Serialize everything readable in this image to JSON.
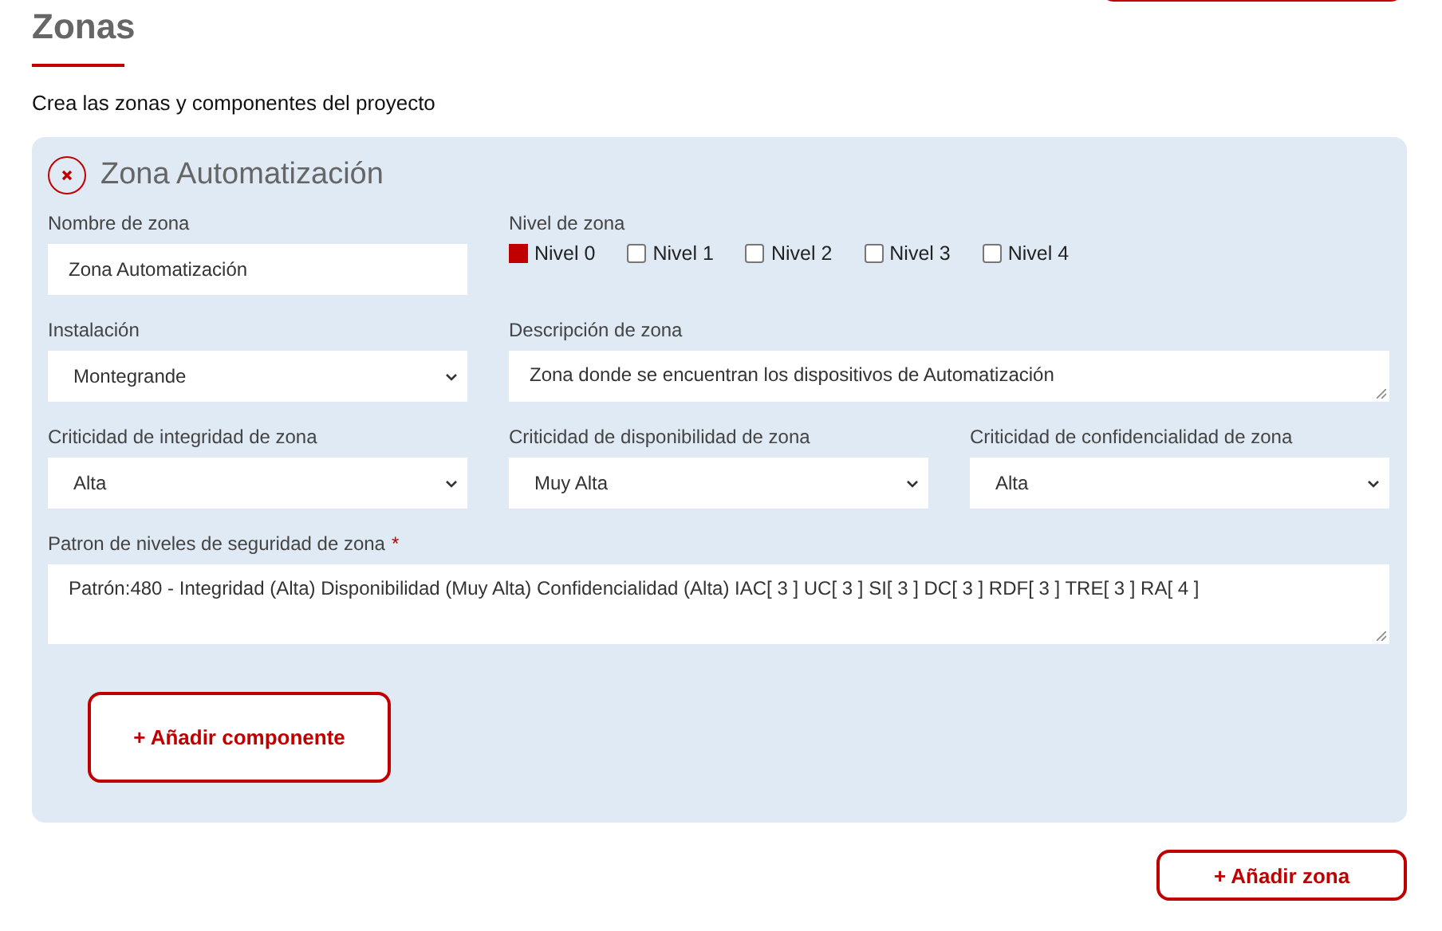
{
  "page": {
    "title": "Zonas",
    "subtitle": "Crea las zonas y componentes del proyecto"
  },
  "zone": {
    "title": "Zona Automatización",
    "name_field": {
      "label": "Nombre de zona",
      "value": "Zona Automatización"
    },
    "level": {
      "label": "Nivel de zona",
      "options": [
        {
          "label": "Nivel 0",
          "checked": true
        },
        {
          "label": "Nivel 1",
          "checked": false
        },
        {
          "label": "Nivel 2",
          "checked": false
        },
        {
          "label": "Nivel 3",
          "checked": false
        },
        {
          "label": "Nivel 4",
          "checked": false
        }
      ]
    },
    "installation": {
      "label": "Instalación",
      "value": "Montegrande"
    },
    "description": {
      "label": "Descripción de zona",
      "value": "Zona donde se encuentran los dispositivos de Automatización"
    },
    "criticality": [
      {
        "label": "Criticidad de integridad de zona",
        "value": "Alta"
      },
      {
        "label": "Criticidad de disponibilidad de zona",
        "value": "Muy Alta"
      },
      {
        "label": "Criticidad de confidencialidad de zona",
        "value": "Alta"
      }
    ],
    "pattern": {
      "label": "Patron de niveles de seguridad de zona",
      "required_mark": "*",
      "value": "Patrón:480 - Integridad (Alta) Disponibilidad (Muy Alta) Confidencialidad (Alta) IAC[ 3 ]  UC[ 3 ]  SI[ 3 ] DC[ 3 ] RDF[ 3 ] TRE[ 3 ] RA[ 4 ]"
    },
    "add_component": "+ Añadir componente"
  },
  "add_zone": "+ Añadir zona"
}
